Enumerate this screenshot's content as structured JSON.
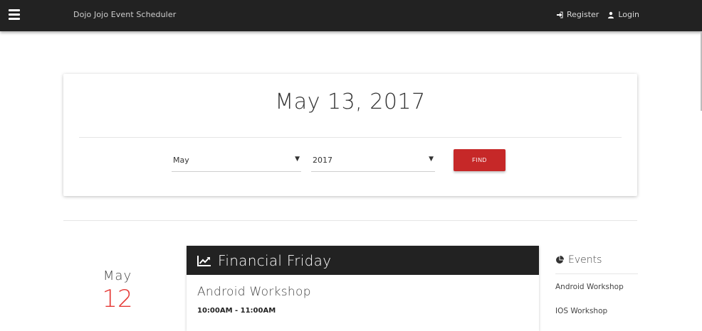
{
  "header": {
    "brand": "Dojo Jojo Event Scheduler",
    "register_label": "Register",
    "login_label": "Login"
  },
  "search_card": {
    "date_title": "May 13, 2017",
    "month_value": "May",
    "year_value": "2017",
    "caret": "▼",
    "find_label": "FIND"
  },
  "schedule": {
    "date": {
      "month": "May",
      "day": "12"
    },
    "event": {
      "category": "Financial Friday",
      "name": "Android Workshop",
      "time": "10:00AM - 11:00AM"
    }
  },
  "sidebar": {
    "title": "Events",
    "items": [
      {
        "label": "Android Workshop"
      },
      {
        "label": "IOS Workshop"
      }
    ]
  },
  "colors": {
    "topbar": "#222222",
    "accent": "#c62828",
    "day_number": "#e53935"
  }
}
